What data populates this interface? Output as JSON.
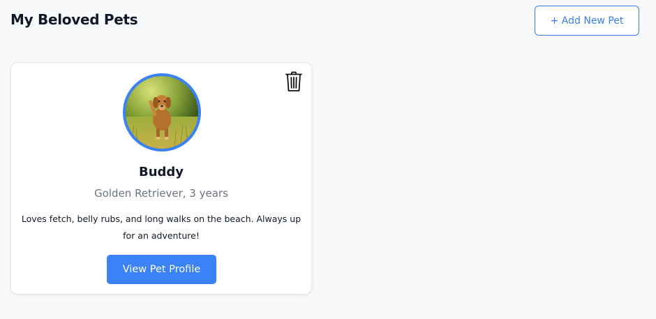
{
  "header": {
    "title": "My Beloved Pets",
    "add_button_label": "+ Add New Pet"
  },
  "pets": [
    {
      "name": "Buddy",
      "details": "Golden Retriever, 3 years",
      "description": "Loves fetch, belly rubs, and long walks on the beach. Always up for an adventure!",
      "view_button_label": "View Pet Profile",
      "avatar": "golden-retriever-running-photo",
      "delete_icon": "trash-icon"
    }
  ],
  "colors": {
    "accent": "#3b82f6",
    "page_background": "#f8f9fb",
    "card_background": "#ffffff",
    "muted_text": "#6b7280"
  }
}
